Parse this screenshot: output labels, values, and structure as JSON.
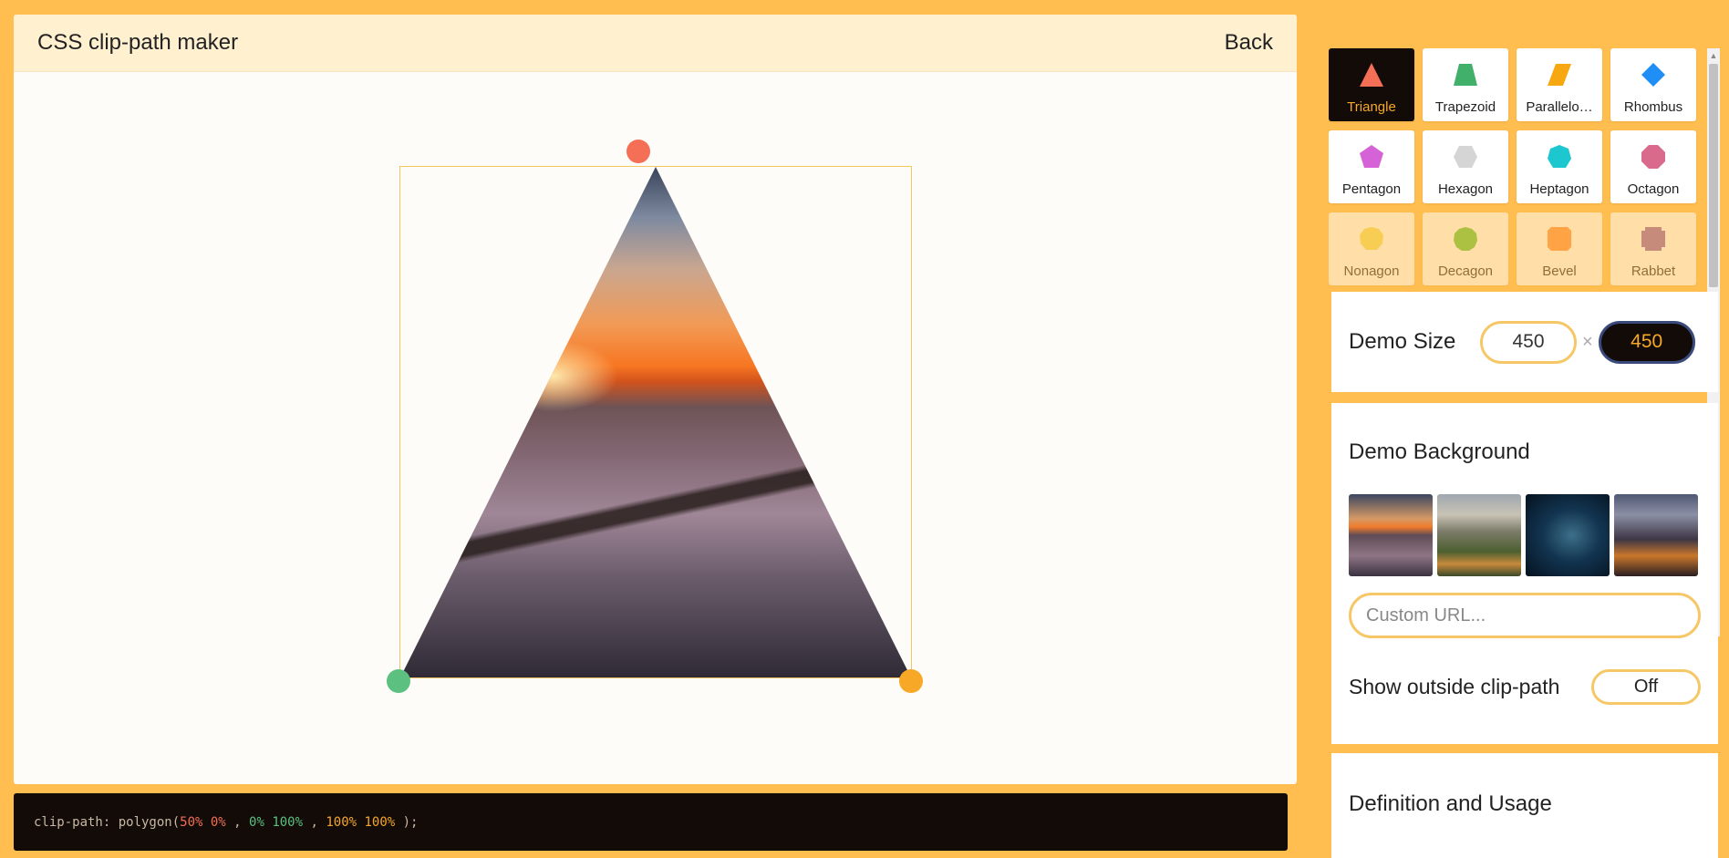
{
  "header": {
    "title": "CSS clip-path maker",
    "back_label": "Back"
  },
  "code": {
    "prefix": "clip-path: polygon(",
    "points": [
      "50% 0%",
      "0% 100%",
      "100% 100%"
    ],
    "separator": " , ",
    "suffix": " );"
  },
  "shapes": [
    {
      "label": "Triangle",
      "icon": "triangle-icon",
      "color": "#f46f55",
      "active": true
    },
    {
      "label": "Trapezoid",
      "icon": "trapezoid-icon",
      "color": "#40b06a",
      "active": false
    },
    {
      "label": "Parallelo…",
      "icon": "parallelogram-icon",
      "color": "#f7a810",
      "active": false
    },
    {
      "label": "Rhombus",
      "icon": "rhombus-icon",
      "color": "#1f8ef5",
      "active": false
    },
    {
      "label": "Pentagon",
      "icon": "pentagon-icon",
      "color": "#d562d6",
      "active": false
    },
    {
      "label": "Hexagon",
      "icon": "hexagon-icon",
      "color": "#d5d5d5",
      "active": false
    },
    {
      "label": "Heptagon",
      "icon": "heptagon-icon",
      "color": "#1cc7cf",
      "active": false
    },
    {
      "label": "Octagon",
      "icon": "octagon-icon",
      "color": "#d96a8b",
      "active": false
    },
    {
      "label": "Nonagon",
      "icon": "nonagon-icon",
      "color": "#f0dc5a",
      "active": false
    },
    {
      "label": "Decagon",
      "icon": "decagon-icon",
      "color": "#5cc434",
      "active": false
    },
    {
      "label": "Bevel",
      "icon": "bevel-icon",
      "color": "#ff8a3d",
      "active": false
    },
    {
      "label": "Rabbet",
      "icon": "rabbet-icon",
      "color": "#8e5aa8",
      "active": false
    }
  ],
  "demo_size": {
    "title": "Demo Size",
    "width": "450",
    "height": "450",
    "separator": "×"
  },
  "demo_background": {
    "title": "Demo Background",
    "thumbnails": [
      "sunset-sea-thumbnail",
      "city-aerial-thumbnail",
      "owl-night-thumbnail",
      "mountain-valley-thumbnail"
    ],
    "custom_url_placeholder": "Custom URL..."
  },
  "show_outside": {
    "label": "Show outside clip-path",
    "value": "Off"
  },
  "definition": {
    "title": "Definition and Usage"
  },
  "colors": {
    "background": "#ffbe4f",
    "point_1": "#f46f55",
    "point_2": "#5cc080",
    "point_3": "#f7a827",
    "dark": "#120b08"
  }
}
